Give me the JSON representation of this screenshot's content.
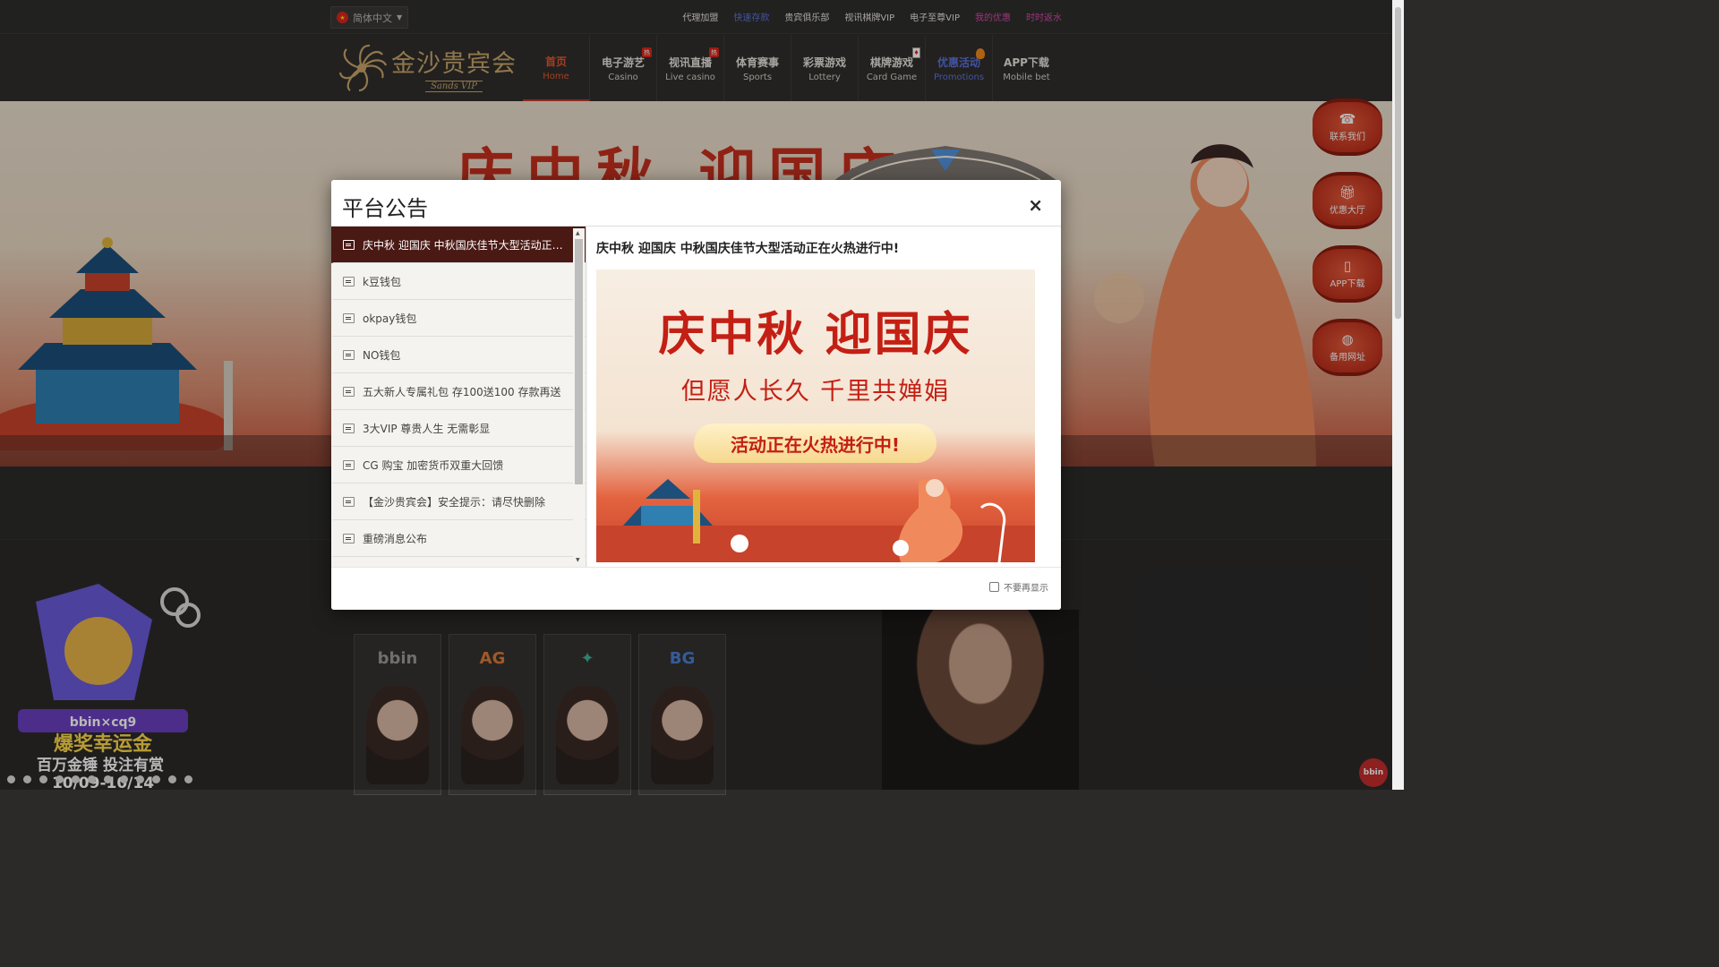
{
  "language": {
    "selected": "简体中文",
    "flag_icon": "china-flag-icon"
  },
  "top_links": [
    {
      "label": "代理加盟",
      "color": "#e8e4de"
    },
    {
      "label": "快速存款",
      "color": "#5a74e0"
    },
    {
      "label": "贵宾俱乐部",
      "color": "#e8e4de"
    },
    {
      "label": "视讯棋牌VIP",
      "color": "#e8e4de"
    },
    {
      "label": "电子至尊VIP",
      "color": "#e8e4de"
    },
    {
      "label": "我的优惠",
      "color": "#d94aa8"
    },
    {
      "label": "时时返水",
      "color": "#d94aa8"
    }
  ],
  "logo": {
    "cn": "金沙贵宾会",
    "en": "Sands VIP"
  },
  "nav": [
    {
      "cn": "首页",
      "en": "Home",
      "state": "active"
    },
    {
      "cn": "电子游艺",
      "en": "Casino",
      "badge": "热"
    },
    {
      "cn": "视讯直播",
      "en": "Live casino",
      "badge": "热"
    },
    {
      "cn": "体育赛事",
      "en": "Sports"
    },
    {
      "cn": "彩票游戏",
      "en": "Lottery"
    },
    {
      "cn": "棋牌游戏",
      "en": "Card Game",
      "badge_icon": "playing-card-icon"
    },
    {
      "cn": "优惠活动",
      "en": "Promotions",
      "state": "promo",
      "badge_icon": "flame-icon"
    },
    {
      "cn": "APP下载",
      "en": "Mobile bet"
    }
  ],
  "banner": {
    "title": "庆中秋 迎国庆"
  },
  "side_float": [
    {
      "label": "联系我们",
      "icon": "headset-icon"
    },
    {
      "label": "优惠大厅",
      "icon": "gift-icon"
    },
    {
      "label": "APP下载",
      "icon": "phone-icon"
    },
    {
      "label": "备用网址",
      "icon": "globe-icon"
    }
  ],
  "game_providers": [
    {
      "name": "bbin",
      "color": "#9a9a9a"
    },
    {
      "name": "AG",
      "color": "#e07a3a"
    },
    {
      "name": "✦",
      "color": "#3fb29a"
    },
    {
      "name": "BG",
      "color": "#4a7fd6"
    }
  ],
  "promo_badge": {
    "title": "爆奖幸运金",
    "sub": "百万金锤 投注有赏",
    "dates": "10/09-10/14",
    "brand": "bbin×cq9"
  },
  "bbin_float": "bbin",
  "modal": {
    "title": "平台公告",
    "close": "×",
    "announcements": [
      "庆中秋 迎国庆 中秋国庆佳节大型活动正在火热进行中!",
      "k豆钱包",
      "okpay钱包",
      "NO钱包",
      "五大新人专属礼包 存100送100 存款再送",
      "3大VIP 尊贵人生 无需彰显",
      "CG 购宝 加密货币双重大回馈",
      "【金沙贵宾会】安全提示：请尽快删除",
      "重磅消息公布"
    ],
    "selected_index": 0,
    "content_heading": "庆中秋 迎国庆 中秋国庆佳节大型活动正在火热进行中!",
    "image": {
      "title": "庆中秋 迎国庆",
      "subtitle": "但愿人长久 千里共婵娟",
      "pill": "活动正在火热进行中!"
    },
    "dont_show_label": "不要再显示"
  }
}
